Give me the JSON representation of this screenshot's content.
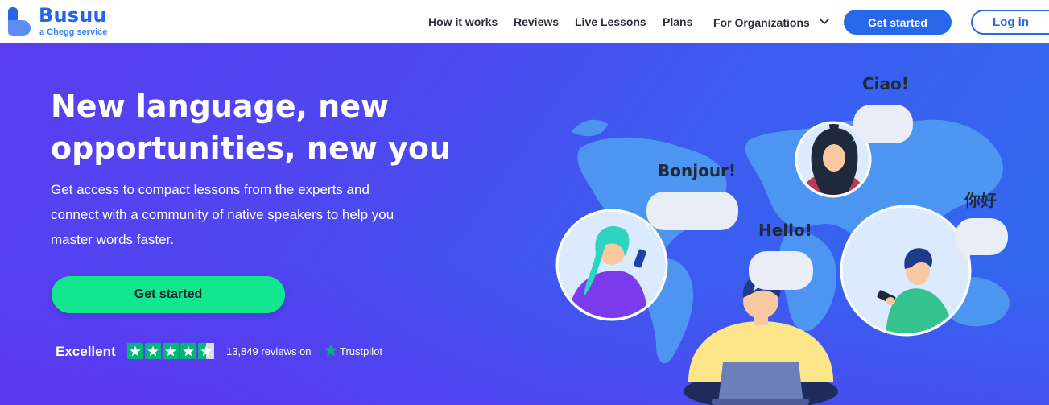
{
  "brand": {
    "name": "Busuu",
    "tagline": "a Chegg service"
  },
  "nav": {
    "items": [
      {
        "label": "How it works"
      },
      {
        "label": "Reviews"
      },
      {
        "label": "Live Lessons"
      },
      {
        "label": "Plans"
      },
      {
        "label": "For Organizations"
      }
    ],
    "get_started": "Get started",
    "login": "Log in"
  },
  "hero": {
    "headline_line1": "New language, new",
    "headline_line2": "opportunities, new you",
    "subtext_line1": "Get access to compact lessons from the experts and",
    "subtext_line2": "connect with a community of native speakers to help you",
    "subtext_line3": "master words faster.",
    "cta": "Get started"
  },
  "trust": {
    "rating_word": "Excellent",
    "stars": 4.5,
    "reviews_text": "13,849 reviews on",
    "platform": "Trustpilot"
  },
  "bubbles": {
    "ciao": "Ciao!",
    "bonjour": "Bonjour!",
    "hello": "Hello!",
    "nihao": "你好"
  },
  "colors": {
    "brand_blue": "#2768e8",
    "cta_green": "#12e68e",
    "trustpilot_green": "#00b67a"
  }
}
